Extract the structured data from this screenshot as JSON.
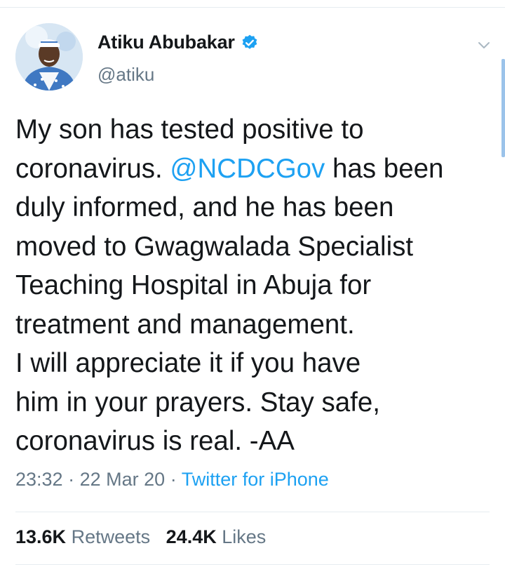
{
  "tweet": {
    "author": {
      "display_name": "Atiku Abubakar",
      "handle": "@atiku",
      "verified": true,
      "avatar_icon": "profile-photo"
    },
    "text_before_mention": "My son has tested positive to\ncoronavirus. ",
    "mention": "@NCDCGov",
    "text_after_mention": " has been\nduly informed, and he has been\nmoved to Gwagwalada Specialist\nTeaching Hospital in Abuja for\ntreatment and management.\nI will appreciate it if you have\nhim in your prayers. Stay safe,\ncoronavirus is real. -AA",
    "time": "23:32",
    "date": "22 Mar 20",
    "separator": "·",
    "source": "Twitter for iPhone",
    "retweets_count": "13.6K",
    "retweets_label": "Retweets",
    "likes_count": "24.4K",
    "likes_label": "Likes"
  },
  "colors": {
    "link": "#1da1f2",
    "secondary_text": "#657786",
    "primary_text": "#14171a",
    "divider": "#e6ecf0"
  }
}
